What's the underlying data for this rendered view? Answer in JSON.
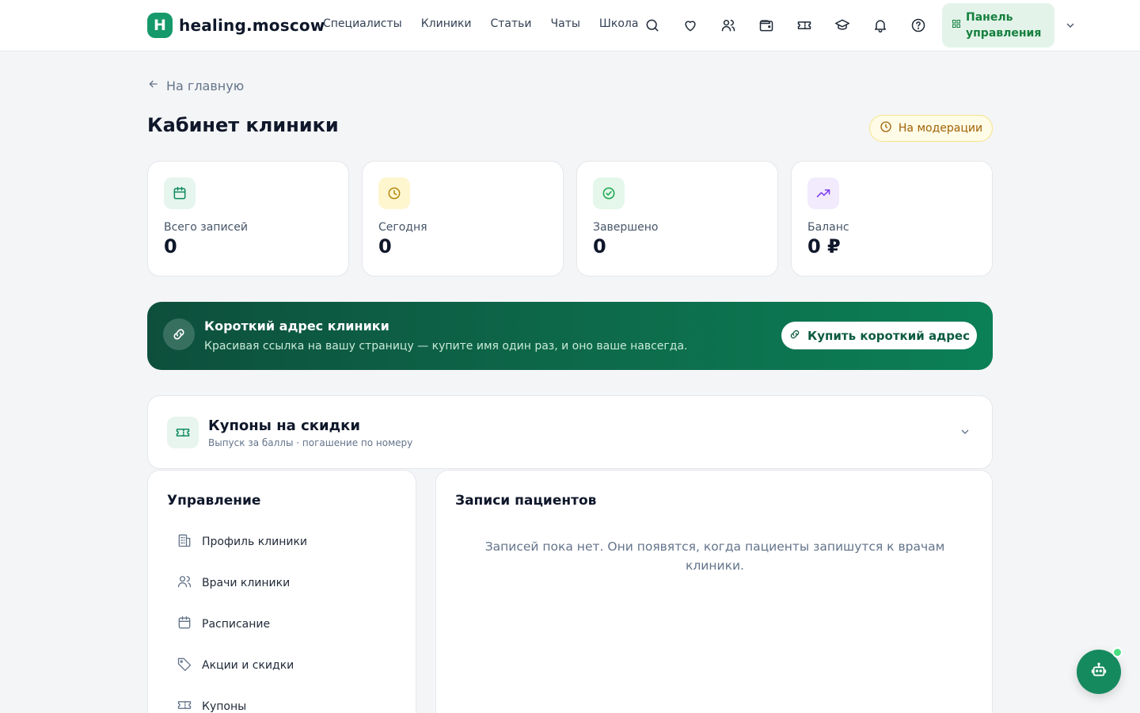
{
  "brand": {
    "mark": "H",
    "name": "healing.moscow",
    "accent": "#16996b"
  },
  "nav": [
    "Специалисты",
    "Клиники",
    "Статьи",
    "Чаты",
    "Школа"
  ],
  "header_icons": [
    "search-icon",
    "heart-icon",
    "users-icon",
    "wallet-icon",
    "ticket-icon",
    "graduation-cap-icon",
    "bell-icon",
    "help-circle-icon"
  ],
  "panel_button": {
    "label": "Панель управления",
    "icon": "grid-icon"
  },
  "back_link": "На главную",
  "page_title": "Кабинет клиники",
  "status_badge": {
    "label": "На модерации",
    "icon": "clock-icon",
    "color": "#a16207"
  },
  "stats": [
    {
      "label": "Всего записей",
      "value": "0",
      "icon": "calendar-icon",
      "color": "#0f8a5f"
    },
    {
      "label": "Сегодня",
      "value": "0",
      "icon": "clock-icon",
      "color": "#b8860b"
    },
    {
      "label": "Завершено",
      "value": "0",
      "icon": "check-circle-icon",
      "color": "#16a34a"
    },
    {
      "label": "Баланс",
      "value": "0 ₽",
      "icon": "trending-up-icon",
      "color": "#7c3aed"
    }
  ],
  "short_address": {
    "title": "Короткий адрес клиники",
    "subtitle": "Красивая ссылка на вашу страницу — купите имя один раз, и оно ваше навсегда.",
    "button": "Купить короткий адрес"
  },
  "coupons": {
    "title": "Купоны на скидки",
    "subtitle": "Выпуск за баллы · погашение по номеру"
  },
  "management": {
    "title": "Управление",
    "items": [
      {
        "label": "Профиль клиники",
        "icon": "building-icon"
      },
      {
        "label": "Врачи клиники",
        "icon": "users-icon"
      },
      {
        "label": "Расписание",
        "icon": "calendar-icon"
      },
      {
        "label": "Акции и скидки",
        "icon": "tag-icon"
      },
      {
        "label": "Купоны",
        "icon": "ticket-icon"
      }
    ]
  },
  "records": {
    "title": "Записи пациентов",
    "empty": "Записей пока нет. Они появятся, когда пациенты запишутся к врачам клиники."
  },
  "assistant": {
    "icon": "bot-icon"
  }
}
